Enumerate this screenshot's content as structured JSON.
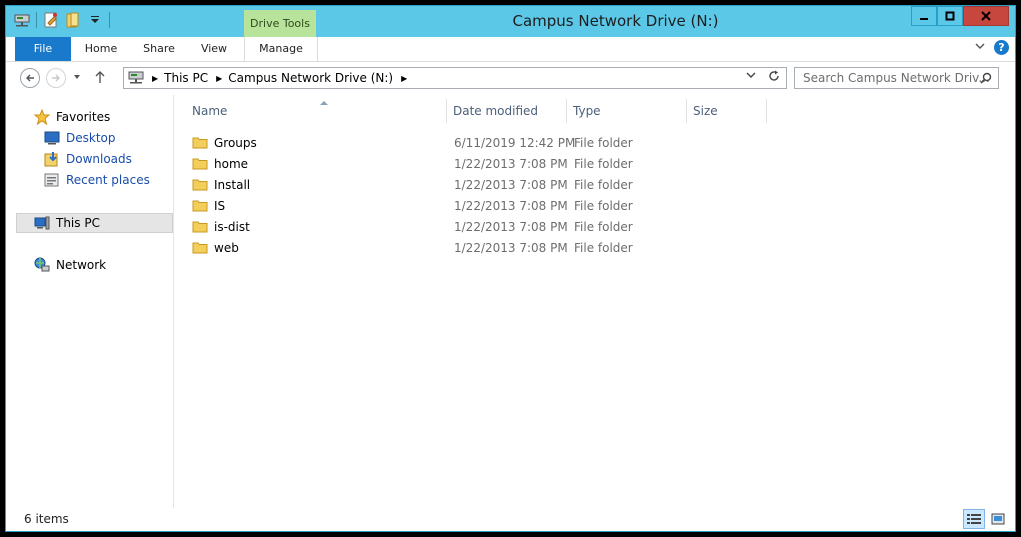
{
  "window": {
    "title": "Campus Network Drive (N:)",
    "context_tab_group": "Drive Tools"
  },
  "ribbon": {
    "tabs": [
      {
        "label": "File"
      },
      {
        "label": "Home"
      },
      {
        "label": "Share"
      },
      {
        "label": "View"
      },
      {
        "label": "Manage"
      }
    ],
    "help_label": "?"
  },
  "address": {
    "crumbs": [
      "This PC",
      "Campus Network Drive (N:)"
    ]
  },
  "search": {
    "placeholder": "Search Campus Network Driv..."
  },
  "navpane": {
    "favorites": "Favorites",
    "desktop": "Desktop",
    "downloads": "Downloads",
    "recent": "Recent places",
    "this_pc": "This PC",
    "network": "Network"
  },
  "columns": {
    "name": "Name",
    "date": "Date modified",
    "type": "Type",
    "size": "Size"
  },
  "files": [
    {
      "name": "Groups",
      "date": "6/11/2019 12:42 PM",
      "type": "File folder"
    },
    {
      "name": "home",
      "date": "1/22/2013 7:08 PM",
      "type": "File folder"
    },
    {
      "name": "Install",
      "date": "1/22/2013 7:08 PM",
      "type": "File folder"
    },
    {
      "name": "IS",
      "date": "1/22/2013 7:08 PM",
      "type": "File folder"
    },
    {
      "name": "is-dist",
      "date": "1/22/2013 7:08 PM",
      "type": "File folder"
    },
    {
      "name": "web",
      "date": "1/22/2013 7:08 PM",
      "type": "File folder"
    }
  ],
  "status": {
    "count": "6 items"
  },
  "colors": {
    "frame": "#5bc8e8",
    "file_tab": "#1979ca",
    "drive_tools": "#b8e39a",
    "close_button": "#c7463d",
    "link": "#1a4dab"
  }
}
